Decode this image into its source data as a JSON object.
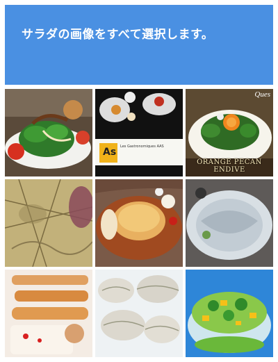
{
  "header": {
    "instruction": "サラダの画像をすべて選択します。",
    "background_color": "#4a90e2"
  },
  "tiles": [
    {
      "row": 1,
      "col": 1,
      "description": "salad"
    },
    {
      "row": 1,
      "col": 2,
      "description": "food platter with as label"
    },
    {
      "row": 1,
      "col": 3,
      "description": "orange pecan endive salad",
      "caption": "ORANGE PECAN ENDIVE",
      "logo": "Ques"
    },
    {
      "row": 2,
      "col": 1,
      "description": "map"
    },
    {
      "row": 2,
      "col": 2,
      "description": "quiche"
    },
    {
      "row": 2,
      "col": 3,
      "description": "fish sashimi"
    },
    {
      "row": 3,
      "col": 1,
      "description": "pastries"
    },
    {
      "row": 3,
      "col": 2,
      "description": "dumplings"
    },
    {
      "row": 3,
      "col": 3,
      "description": "salad bowl"
    }
  ],
  "tile_2_label": {
    "badge": "As",
    "text": "Les Gastronomiques AAS"
  }
}
